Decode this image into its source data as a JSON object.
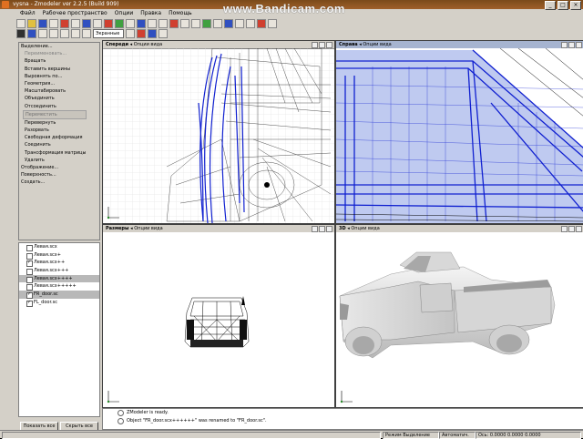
{
  "window": {
    "title": "vysna - Zmodeler ver 2.2.5 (Build 909)",
    "watermark": "www.Bandicam.com",
    "controls": [
      "_",
      "□",
      "×"
    ]
  },
  "menu": [
    "Файл",
    "Рабочее пространство",
    "Опции",
    "Правка",
    "Помощь"
  ],
  "toolbar": {
    "select_value": "Экранные"
  },
  "left_panel": {
    "items": [
      {
        "label": "Выделение...",
        "kind": "head"
      },
      {
        "label": "Переименовать...",
        "kind": "dis"
      },
      {
        "label": "Вращать",
        "kind": "item"
      },
      {
        "label": "Вставить вершины",
        "kind": "item"
      },
      {
        "label": "Выровнять по...",
        "kind": "item"
      },
      {
        "label": "Геометрия...",
        "kind": "item"
      },
      {
        "label": "Масштабировать",
        "kind": "item"
      },
      {
        "label": "Объединить",
        "kind": "item"
      },
      {
        "label": "Отсоединить",
        "kind": "item"
      },
      {
        "label": "Переместить",
        "kind": "sel"
      },
      {
        "label": "Перевернуть",
        "kind": "item"
      },
      {
        "label": "Разорвать",
        "kind": "item"
      },
      {
        "label": "Свободная деформация",
        "kind": "item"
      },
      {
        "label": "Соединить",
        "kind": "item"
      },
      {
        "label": "Трансформация матрицы",
        "kind": "item"
      },
      {
        "label": "Удалить",
        "kind": "item"
      },
      {
        "label": "Отображение...",
        "kind": "head"
      },
      {
        "label": "Поверхность...",
        "kind": "head"
      },
      {
        "label": "Создать...",
        "kind": "head"
      }
    ]
  },
  "object_list": [
    {
      "name": "Левая.scx",
      "checked": false,
      "selected": false
    },
    {
      "name": "Левая.scx+",
      "checked": false,
      "selected": false
    },
    {
      "name": "Левая.scx++",
      "checked": true,
      "selected": false
    },
    {
      "name": "Левая.scx+++",
      "checked": false,
      "selected": false
    },
    {
      "name": "Левая.scx++++",
      "checked": false,
      "selected": true
    },
    {
      "name": "Левая.scx+++++",
      "checked": false,
      "selected": false
    },
    {
      "name": "FR_door.sc",
      "checked": true,
      "selected": true
    },
    {
      "name": "FL_door.sc",
      "checked": true,
      "selected": false
    }
  ],
  "left_buttons": {
    "show_all": "Показать все",
    "hide_all": "Скрыть все"
  },
  "viewports": {
    "front": {
      "name": "Спереди",
      "mode": "Опции вида"
    },
    "right": {
      "name": "Справа",
      "mode": "Опции вида"
    },
    "top": {
      "name": "Размеры",
      "mode": "Опции вида"
    },
    "persp": {
      "name": "3D",
      "mode": "Опции вида"
    }
  },
  "console": {
    "line1": "ZModeler is ready.",
    "line2": "Object \"FR_door.scx++++++\" was renamed to \"FR_door.sc\"."
  },
  "status": {
    "mode": "Режим Выделение",
    "auto": "Автоматич.",
    "coords": "Ось: 0.0000 0.0000 0.0000"
  },
  "colors": {
    "wire_blue": "#1020d0",
    "wire_black": "#000000",
    "grid": "#d8d8d8"
  }
}
